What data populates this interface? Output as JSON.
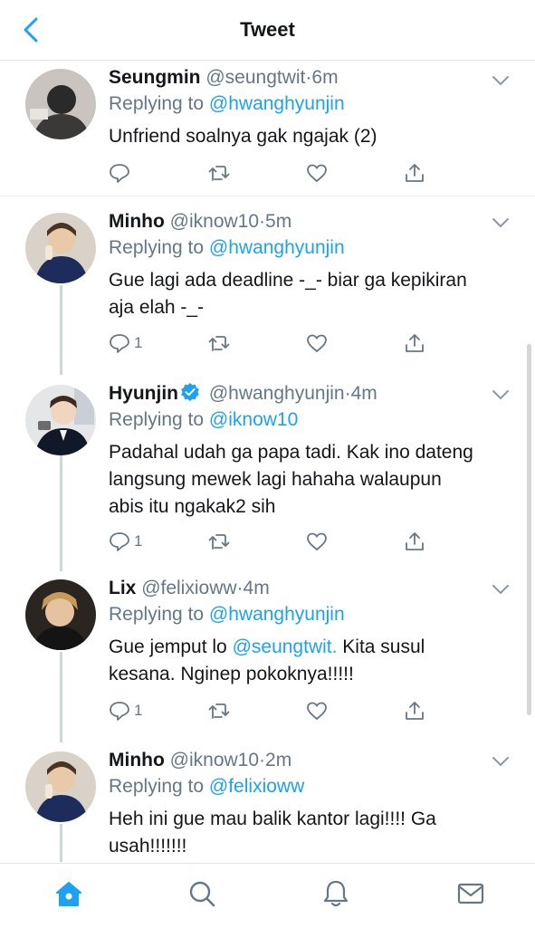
{
  "header": {
    "title": "Tweet"
  },
  "tweets": [
    {
      "name": "Seungmin",
      "handle": "@seungtwit",
      "separator": "·",
      "time": "6m",
      "replying_prefix": "Replying to",
      "replying_to": "@hwanghyunjin",
      "text": "Unfriend soalnya gak ngajak (2)",
      "reply_count": "",
      "verified": false
    },
    {
      "name": "Minho",
      "handle": "@iknow10",
      "separator": "·",
      "time": "5m",
      "replying_prefix": "Replying to",
      "replying_to": "@hwanghyunjin",
      "text_line1": "Gue lagi ada deadline -_- biar ga kepikiran",
      "text_line2": "aja elah -_-",
      "reply_count": "1",
      "verified": false
    },
    {
      "name": "Hyunjin",
      "handle": "@hwanghyunjin",
      "separator": "·",
      "time": "4m",
      "replying_prefix": "Replying to",
      "replying_to": "@iknow10",
      "text_line1": "Padahal udah ga papa tadi. Kak ino dateng",
      "text_line2": "langsung mewek lagi hahaha walaupun",
      "text_line3": "abis itu ngakak2 sih",
      "reply_count": "1",
      "verified": true
    },
    {
      "name": "Lix",
      "handle": "@felixioww",
      "separator": "·",
      "time": "4m",
      "replying_prefix": "Replying to",
      "replying_to": "@hwanghyunjin",
      "text_pre": "Gue jemput lo ",
      "text_mention": "@seungtwit.",
      "text_post": " Kita susul",
      "text_line2": "kesana. Nginep pokoknya!!!!!",
      "reply_count": "1",
      "verified": false
    },
    {
      "name": "Minho",
      "handle": "@iknow10",
      "separator": "·",
      "time": "2m",
      "replying_prefix": "Replying to",
      "replying_to": "@felixioww",
      "text_line1": "Heh ini gue mau balik kantor lagi!!!! Ga",
      "text_line2": "usah!!!!!!!",
      "verified": false
    }
  ],
  "icons": {
    "back": "chevron-left-icon",
    "reply": "reply-icon",
    "retweet": "retweet-icon",
    "like": "heart-icon",
    "share": "share-icon",
    "more": "chevron-down-icon",
    "home": "home-icon",
    "search": "search-icon",
    "notifications": "bell-icon",
    "messages": "mail-icon"
  },
  "colors": {
    "accent": "#1da1f2",
    "text": "#14171a",
    "secondary": "#657786"
  }
}
